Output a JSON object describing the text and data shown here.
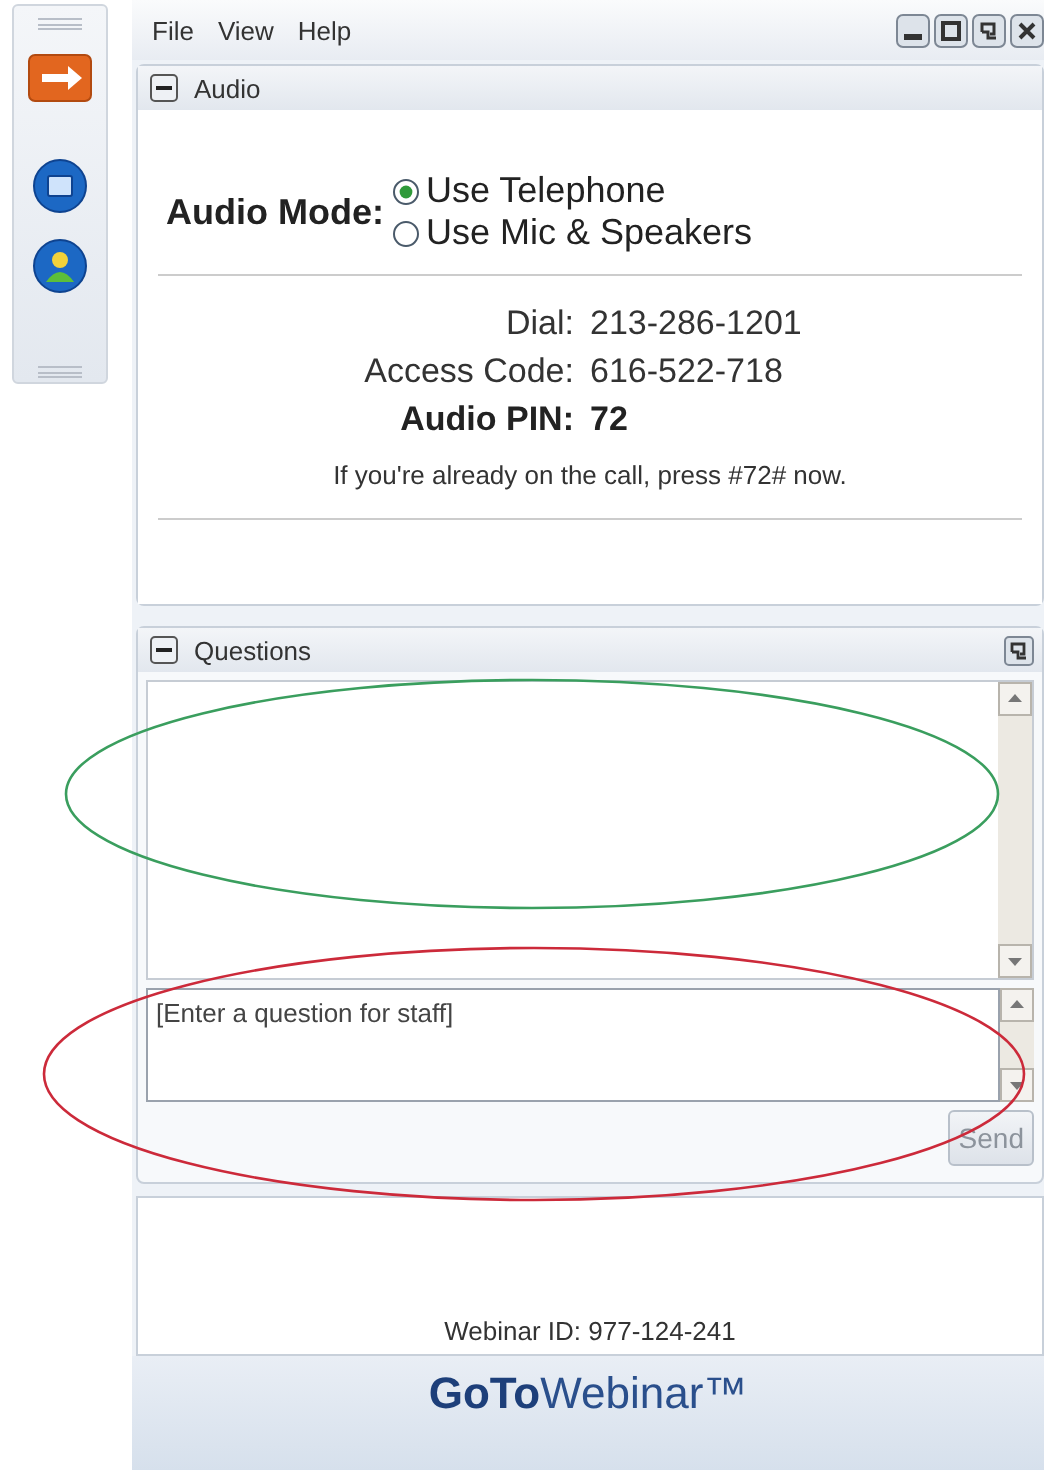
{
  "menu": [
    "File",
    "View",
    "Help"
  ],
  "audio": {
    "title": "Audio",
    "expanded": true,
    "mode_label": "Audio Mode:",
    "options": [
      {
        "label": "Use Telephone",
        "selected": true
      },
      {
        "label": "Use Mic & Speakers",
        "selected": false
      }
    ],
    "details": [
      {
        "label": "Dial:",
        "value": "213-286-1201",
        "bold": false
      },
      {
        "label": "Access Code:",
        "value": "616-522-718",
        "bold": false
      },
      {
        "label": "Audio PIN:",
        "value": "72",
        "bold": true
      }
    ],
    "note": "If you're already on the call, press #72# now."
  },
  "questions": {
    "title": "Questions",
    "expanded": true,
    "input": {
      "placeholder": "[Enter a question for staff]"
    },
    "send": {
      "label": "Send",
      "disabled": true
    }
  },
  "footer": {
    "webinar_id": "Webinar ID: 977-124-241",
    "logo": "**GoTo**Webinar™"
  },
  "annotations": [
    {
      "color": "#3a9e5e"
    },
    {
      "color": "#cc2a3a"
    }
  ]
}
